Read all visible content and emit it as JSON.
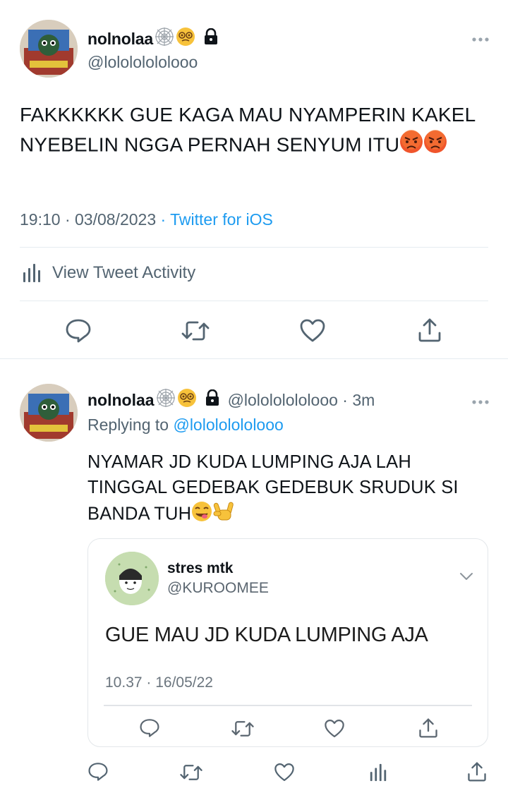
{
  "main_tweet": {
    "display_name": "nolnolaa",
    "handle": "@lolololololooo",
    "text": "FAKKKKKK GUE KAGA MAU NYAMPERIN KAKEL NYEBELIN NGGA PERNAH SENYUM ITU",
    "time": "19:10 · 03/08/2023",
    "separator": " · ",
    "source": "Twitter for iOS",
    "activity_label": "View Tweet Activity"
  },
  "reply_tweet": {
    "display_name": "nolnolaa",
    "handle_time": "@lolololololooo · 3m",
    "replying_label": "Replying to",
    "replying_to": "@lolololololooo",
    "text": "NYAMAR JD KUDA LUMPING AJA LAH TINGGAL GEDEBAK GEDEBUK SRUDUK SI BANDA TUH"
  },
  "quoted_tweet": {
    "display_name": "stres mtk",
    "handle": "@KUROOMEE",
    "text": "GUE MAU JD KUDA LUMPING AJA",
    "time": "10.37 · 16/05/22"
  },
  "icons": {
    "name_emojis": [
      "spider-web-icon",
      "woozy-face-icon",
      "lock-icon"
    ],
    "text_emojis_main": [
      "angry-face-icon",
      "angry-face-icon"
    ],
    "text_emojis_reply": [
      "yum-face-icon",
      "rock-hand-icon"
    ],
    "actions": [
      "reply-icon",
      "retweet-icon",
      "like-icon",
      "share-icon",
      "analytics-icon"
    ]
  },
  "colors": {
    "link": "#1d9bf0",
    "text": "#0f1419",
    "secondary": "#536471",
    "border": "#e6ecf0"
  }
}
